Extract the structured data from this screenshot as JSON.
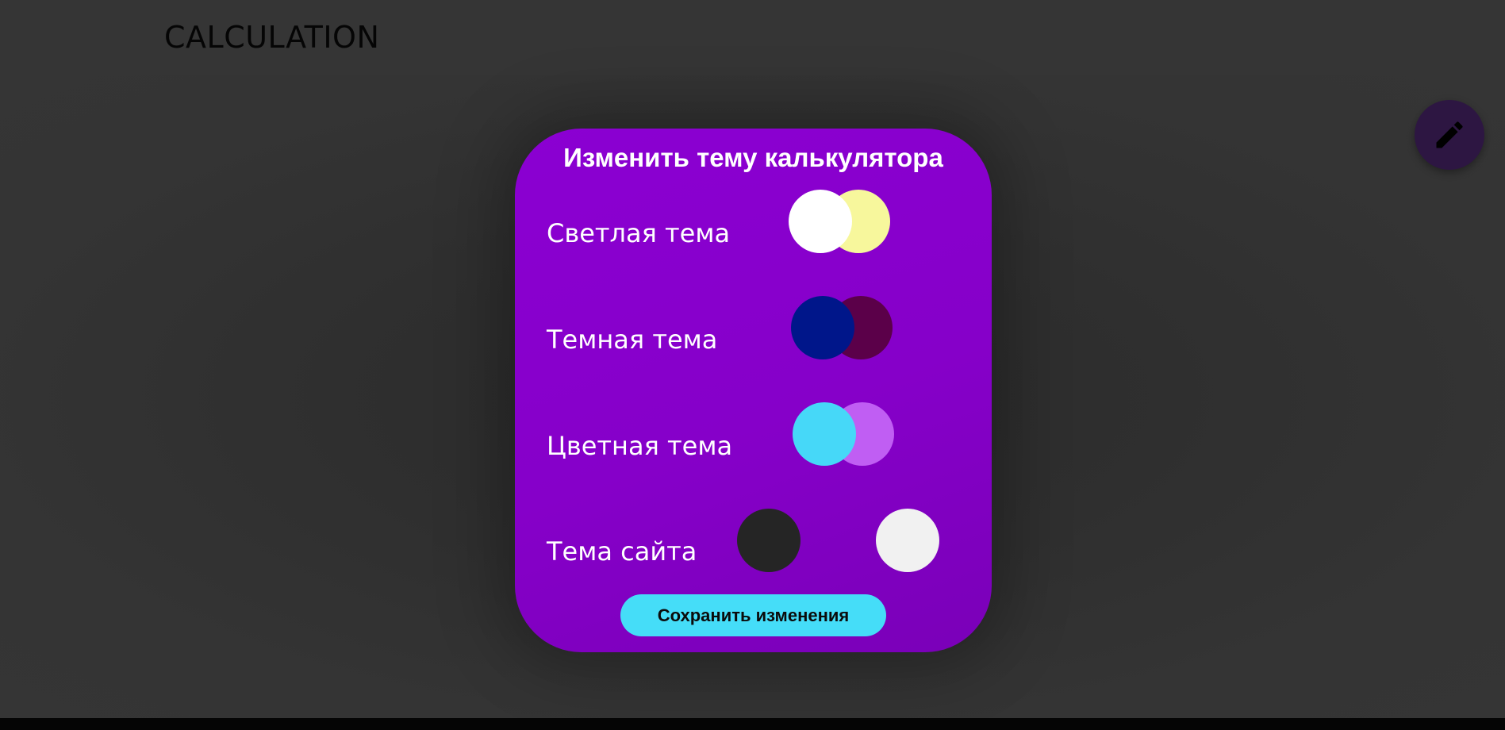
{
  "app": {
    "title": "CALCULATION"
  },
  "toolbar": {
    "edit_icon": "pencil-icon"
  },
  "modal": {
    "title": "Изменить тему калькулятора",
    "themes": [
      {
        "label": "Светлая тема",
        "colors": {
          "primary": "#ffffff",
          "secondary": "#f7f79c"
        }
      },
      {
        "label": "Темная тема",
        "colors": {
          "primary": "#00168a",
          "secondary": "#5b0049"
        }
      },
      {
        "label": "Цветная тема",
        "colors": {
          "primary": "#46d8f8",
          "secondary": "#c05ef3"
        }
      }
    ],
    "site_theme": {
      "label": "Тема сайта",
      "colors": {
        "dark": "#252525",
        "light": "#f1f1f1"
      }
    },
    "save_label": "Сохранить изменения"
  },
  "colors": {
    "modal_background": "#8a00cf",
    "accent": "#45ddf8",
    "page_background": "#323232",
    "header_background": "#353535",
    "fab_background": "#2d1642"
  }
}
